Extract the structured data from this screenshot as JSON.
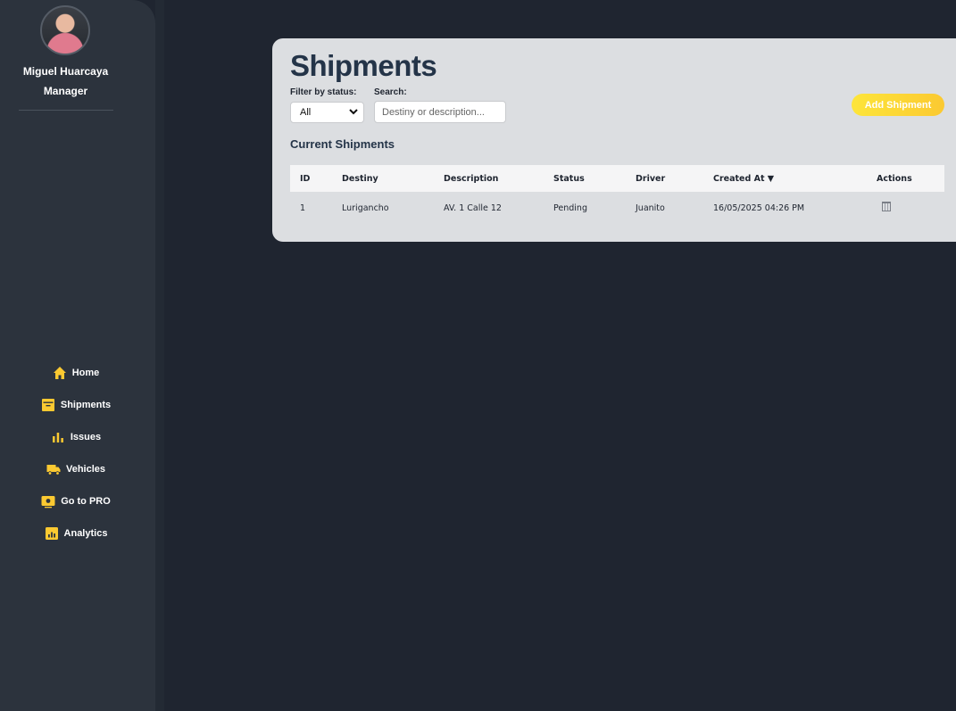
{
  "profile": {
    "name": "Miguel Huarcaya",
    "role": "Manager"
  },
  "nav": [
    {
      "label": "Home",
      "icon": "home-icon"
    },
    {
      "label": "Shipments",
      "icon": "box-icon"
    },
    {
      "label": "Issues",
      "icon": "bar-chart-icon"
    },
    {
      "label": "Vehicles",
      "icon": "truck-icon"
    },
    {
      "label": "Go to PRO",
      "icon": "pro-icon"
    },
    {
      "label": "Analytics",
      "icon": "analytics-icon"
    }
  ],
  "page": {
    "title": "Shipments",
    "filter_label": "Filter by status:",
    "filter_value": "All",
    "search_label": "Search:",
    "search_placeholder": "Destiny or description...",
    "add_button": "Add Shipment",
    "section_title": "Current Shipments"
  },
  "table": {
    "headers": [
      "ID",
      "Destiny",
      "Description",
      "Status",
      "Driver",
      "Created At ▼",
      "Actions"
    ],
    "rows": [
      [
        "1",
        "Lurigancho",
        "AV. 1 Calle 12",
        "Pending",
        "Juanito",
        "16/05/2025 04:26 PM"
      ]
    ]
  },
  "colors": {
    "accent": "#fbc931",
    "sidebar": "#2c333d",
    "background": "#1f2530",
    "card": "#dcdee1",
    "title": "#243448"
  }
}
